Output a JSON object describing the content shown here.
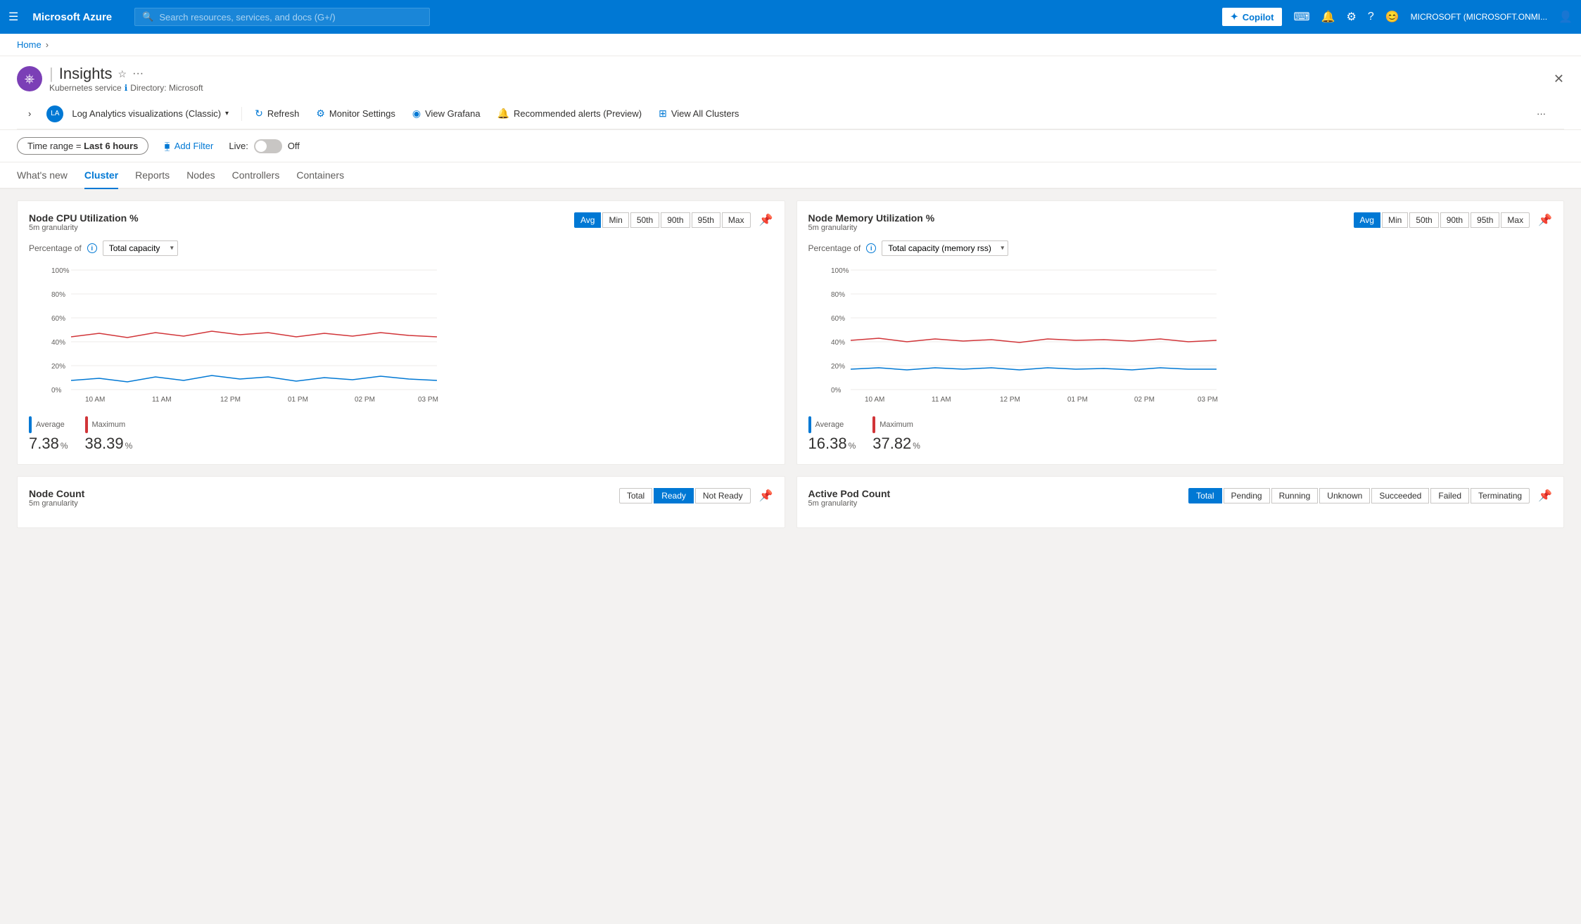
{
  "topnav": {
    "hamburger": "☰",
    "brand": "Microsoft Azure",
    "search_placeholder": "Search resources, services, and docs (G+/)",
    "copilot_label": "Copilot",
    "user_label": "MICROSOFT (MICROSOFT.ONMI..."
  },
  "breadcrumb": {
    "home": "Home"
  },
  "page_header": {
    "title": "Insights",
    "subtitle_label": "Kubernetes service",
    "directory_label": "Directory: Microsoft",
    "icon": "⎈"
  },
  "toolbar": {
    "analytics_label": "Log Analytics visualizations (Classic)",
    "refresh_label": "Refresh",
    "monitor_settings_label": "Monitor Settings",
    "view_grafana_label": "View Grafana",
    "recommended_alerts_label": "Recommended alerts (Preview)",
    "view_all_clusters_label": "View All Clusters"
  },
  "filter_bar": {
    "time_range_prefix": "Time range =",
    "time_range_value": "Last 6 hours",
    "add_filter_label": "Add Filter",
    "live_label": "Live:",
    "live_off_label": "Off"
  },
  "tabs": [
    {
      "label": "What's new",
      "active": false
    },
    {
      "label": "Cluster",
      "active": true
    },
    {
      "label": "Reports",
      "active": false
    },
    {
      "label": "Nodes",
      "active": false
    },
    {
      "label": "Controllers",
      "active": false
    },
    {
      "label": "Containers",
      "active": false
    }
  ],
  "cpu_chart": {
    "title": "Node CPU Utilization %",
    "granularity": "5m granularity",
    "buttons": [
      "Avg",
      "Min",
      "50th",
      "90th",
      "95th",
      "Max"
    ],
    "active_button": "Avg",
    "percentage_of_label": "Percentage of",
    "dropdown_value": "Total capacity",
    "y_axis": [
      "100%",
      "80%",
      "60%",
      "40%",
      "20%",
      "0%"
    ],
    "x_axis": [
      "10 AM",
      "11 AM",
      "12 PM",
      "01 PM",
      "02 PM",
      "03 PM"
    ],
    "legend_avg_label": "Average",
    "legend_avg_value": "7.38",
    "legend_avg_pct": "%",
    "legend_max_label": "Maximum",
    "legend_max_value": "38.39",
    "legend_max_pct": "%",
    "avg_color": "#0078d4",
    "max_color": "#d13438"
  },
  "memory_chart": {
    "title": "Node Memory Utilization %",
    "granularity": "5m granularity",
    "buttons": [
      "Avg",
      "Min",
      "50th",
      "90th",
      "95th",
      "Max"
    ],
    "active_button": "Avg",
    "percentage_of_label": "Percentage of",
    "dropdown_value": "Total capacity (memory rss)",
    "y_axis": [
      "100%",
      "80%",
      "60%",
      "40%",
      "20%",
      "0%"
    ],
    "x_axis": [
      "10 AM",
      "11 AM",
      "12 PM",
      "01 PM",
      "02 PM",
      "03 PM"
    ],
    "legend_avg_label": "Average",
    "legend_avg_value": "16.38",
    "legend_avg_pct": "%",
    "legend_max_label": "Maximum",
    "legend_max_value": "37.82",
    "legend_max_pct": "%",
    "avg_color": "#0078d4",
    "max_color": "#d13438"
  },
  "node_count": {
    "title": "Node Count",
    "granularity": "5m granularity",
    "buttons": [
      "Total",
      "Ready",
      "Not Ready"
    ],
    "active_button": "Total"
  },
  "pod_count": {
    "title": "Active Pod Count",
    "granularity": "5m granularity",
    "buttons": [
      "Total",
      "Pending",
      "Running",
      "Unknown",
      "Succeeded",
      "Failed",
      "Terminating"
    ]
  }
}
